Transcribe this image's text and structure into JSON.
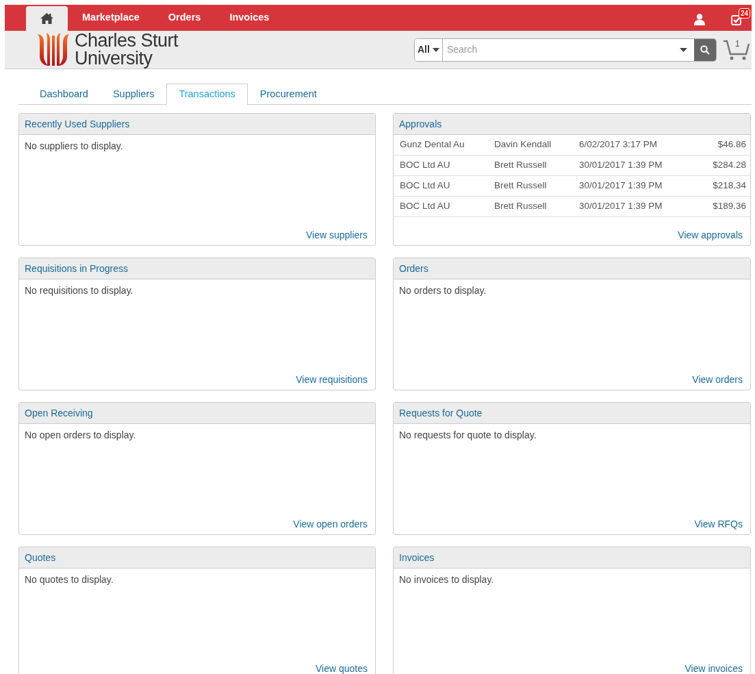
{
  "top_nav": {
    "items": [
      {
        "kind": "home",
        "selected": true
      },
      {
        "kind": "link",
        "label": "Marketplace",
        "selected": false
      },
      {
        "kind": "link",
        "label": "Orders",
        "selected": false
      },
      {
        "kind": "link",
        "label": "Invoices",
        "selected": false
      }
    ],
    "notifications_badge": "24"
  },
  "logo": {
    "line_1": "Charles Sturt",
    "line_2": "University"
  },
  "search": {
    "scope": "All",
    "placeholder": "Search"
  },
  "cart": {
    "count": "1"
  },
  "tabs": [
    {
      "label": "Dashboard",
      "selected": false
    },
    {
      "label": "Suppliers",
      "selected": false
    },
    {
      "label": "Transactions",
      "selected": true
    },
    {
      "label": "Procurement",
      "selected": false
    }
  ],
  "panels": [
    {
      "title": "Recently Used Suppliers",
      "empty_text": "No suppliers to display.",
      "link": "View suppliers"
    },
    {
      "title": "Approvals",
      "rows": [
        {
          "supplier": "Gunz Dental Au",
          "requester": "Davin Kendall",
          "date": "6/02/2017 3:17 PM",
          "amount": "$46.86"
        },
        {
          "supplier": "BOC Ltd AU",
          "requester": "Brett Russell",
          "date": "30/01/2017 1:39 PM",
          "amount": "$284.28"
        },
        {
          "supplier": "BOC Ltd AU",
          "requester": "Brett Russell",
          "date": "30/01/2017 1:39 PM",
          "amount": "$218.34"
        },
        {
          "supplier": "BOC Ltd AU",
          "requester": "Brett Russell",
          "date": "30/01/2017 1:39 PM",
          "amount": "$189.36"
        }
      ],
      "link": "View approvals"
    },
    {
      "title": "Requisitions in Progress",
      "empty_text": "No requisitions to display.",
      "link": "View requisitions"
    },
    {
      "title": "Orders",
      "empty_text": "No orders to display.",
      "link": "View orders"
    },
    {
      "title": "Open Receiving",
      "empty_text": "No open orders to display.",
      "link": "View open orders"
    },
    {
      "title": "Requests for Quote",
      "empty_text": "No requests for quote to display.",
      "link": "View RFQs"
    },
    {
      "title": "Quotes",
      "empty_text": "No quotes to display.",
      "link": "View quotes"
    },
    {
      "title": "Invoices",
      "empty_text": "No invoices to display.",
      "link": "View invoices"
    }
  ]
}
